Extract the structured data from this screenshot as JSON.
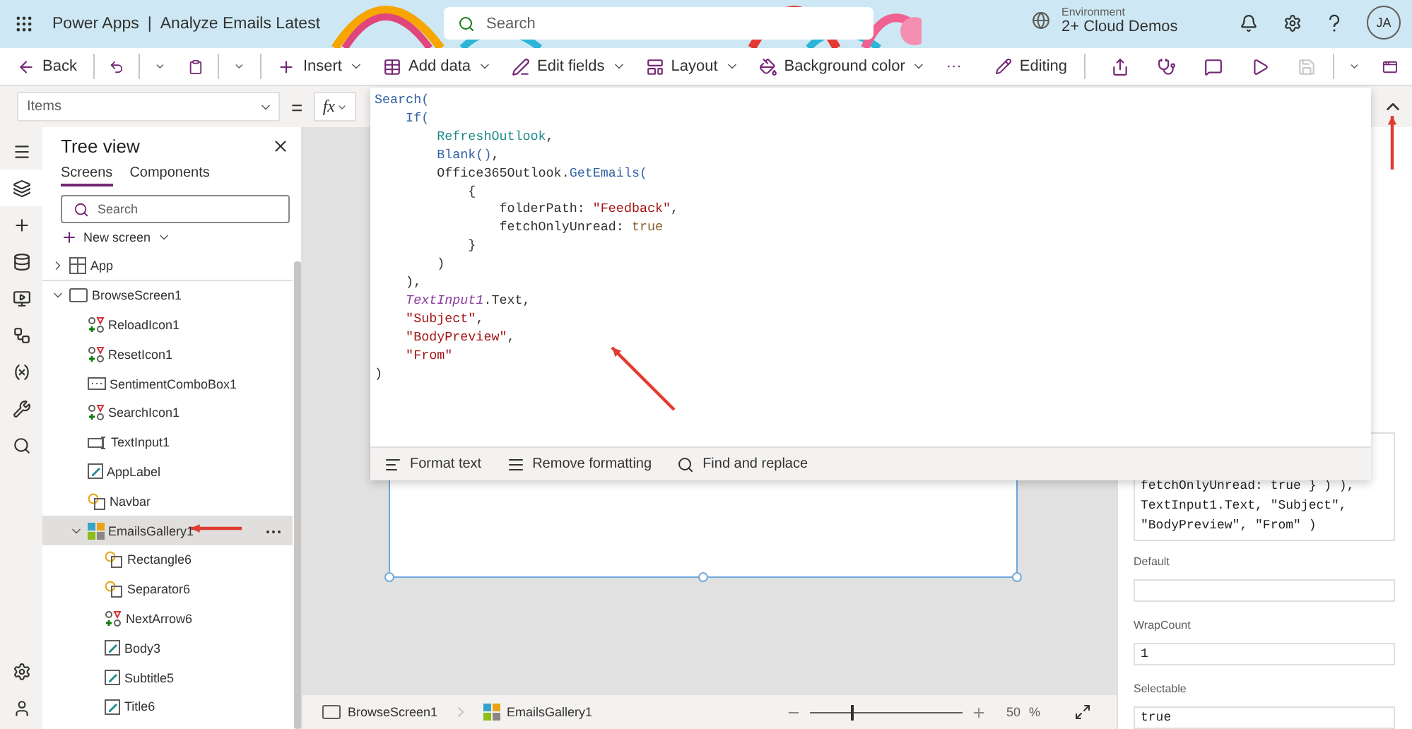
{
  "header": {
    "app_name": "Power Apps",
    "separator": "|",
    "app_title": "Analyze Emails Latest",
    "search": {
      "placeholder": "Search"
    },
    "environment": {
      "label": "Environment",
      "name": "2+ Cloud Demos"
    },
    "avatar": "JA"
  },
  "command_bar": {
    "left": [
      {
        "label": "Back",
        "dropdown": false
      },
      {
        "label": "Insert",
        "dropdown": true
      },
      {
        "label": "Add data",
        "dropdown": true
      },
      {
        "label": "Edit fields",
        "dropdown": true
      },
      {
        "label": "Layout",
        "dropdown": true
      },
      {
        "label": "Background color",
        "dropdown": true
      }
    ],
    "more": "···",
    "mode": "Editing",
    "tools": [
      {
        "disabled": false
      },
      {
        "disabled": false
      },
      {
        "disabled": false
      },
      {
        "disabled": false
      },
      {
        "disabled": true
      }
    ]
  },
  "formula_bar": {
    "property": "Items",
    "equals": "=",
    "fx": "fx",
    "code": [
      [
        {
          "text": "Search(",
          "kind": "func"
        }
      ],
      [
        {
          "text": "    If(",
          "kind": "func"
        }
      ],
      [
        {
          "text": "        RefreshOutlook",
          "kind": "ident"
        },
        {
          "text": ",",
          "kind": "plain"
        }
      ],
      [
        {
          "text": "        Blank()",
          "kind": "func"
        },
        {
          "text": ",",
          "kind": "plain"
        }
      ],
      [
        {
          "text": "        Office365Outlook.",
          "kind": "plain"
        },
        {
          "text": "GetEmails(",
          "kind": "func"
        }
      ],
      [
        {
          "text": "            {",
          "kind": "plain"
        }
      ],
      [
        {
          "text": "                folderPath: ",
          "kind": "plain"
        },
        {
          "text": "\"Feedback\"",
          "kind": "string"
        },
        {
          "text": ",",
          "kind": "plain"
        }
      ],
      [
        {
          "text": "                fetchOnlyUnread: ",
          "kind": "plain"
        },
        {
          "text": "true",
          "kind": "bool"
        }
      ],
      [
        {
          "text": "            }",
          "kind": "plain"
        }
      ],
      [
        {
          "text": "        )",
          "kind": "plain"
        }
      ],
      [
        {
          "text": "    ),",
          "kind": "plain"
        }
      ],
      [
        {
          "text": "    TextInput1",
          "kind": "control"
        },
        {
          "text": ".Text,",
          "kind": "plain"
        }
      ],
      [
        {
          "text": "    \"Subject\"",
          "kind": "string"
        },
        {
          "text": ",",
          "kind": "plain"
        }
      ],
      [
        {
          "text": "    \"BodyPreview\"",
          "kind": "string"
        },
        {
          "text": ",",
          "kind": "plain"
        }
      ],
      [
        {
          "text": "    \"From\"",
          "kind": "string"
        }
      ],
      [
        {
          "text": ")",
          "kind": "plain"
        }
      ]
    ],
    "toolbar": [
      "Format text",
      "Remove formatting",
      "Find and replace"
    ]
  },
  "rail": {
    "items": [
      {
        "selected": false
      },
      {
        "selected": true
      },
      {
        "selected": false
      },
      {
        "selected": false
      },
      {
        "selected": false
      },
      {
        "selected": false
      },
      {
        "selected": false
      },
      {
        "selected": false
      },
      {
        "selected": false
      }
    ]
  },
  "tree_view": {
    "title": "Tree view",
    "tabs": [
      {
        "label": "Screens",
        "selected": true
      },
      {
        "label": "Components",
        "selected": false
      }
    ],
    "search": {
      "placeholder": "Search"
    },
    "new_screen": "New screen",
    "items": [
      {
        "label": "App",
        "kind": "app",
        "expanded": false,
        "selected": false
      },
      {
        "label": "BrowseScreen1",
        "kind": "screen",
        "expanded": true,
        "selected": false,
        "children": [
          {
            "label": "ReloadIcon1",
            "kind": "icon",
            "selected": false
          },
          {
            "label": "ResetIcon1",
            "kind": "icon",
            "selected": false
          },
          {
            "label": "SentimentComboBox1",
            "kind": "combo",
            "selected": false
          },
          {
            "label": "SearchIcon1",
            "kind": "icon",
            "selected": false
          },
          {
            "label": "TextInput1",
            "kind": "input",
            "selected": false
          },
          {
            "label": "AppLabel",
            "kind": "label",
            "selected": false
          },
          {
            "label": "Navbar",
            "kind": "shape",
            "selected": false
          },
          {
            "label": "EmailsGallery1",
            "kind": "gallery",
            "expanded": true,
            "selected": true,
            "children": [
              {
                "label": "Rectangle6",
                "kind": "shape",
                "selected": false
              },
              {
                "label": "Separator6",
                "kind": "shape",
                "selected": false
              },
              {
                "label": "NextArrow6",
                "kind": "icon",
                "selected": false
              },
              {
                "label": "Body3",
                "kind": "label",
                "selected": false
              },
              {
                "label": "Subtitle5",
                "kind": "label",
                "selected": false
              },
              {
                "label": "Title6",
                "kind": "label",
                "selected": false
              }
            ]
          }
        ]
      }
    ]
  },
  "status_bar": {
    "breadcrumbs": [
      {
        "label": "BrowseScreen1",
        "kind": "screen"
      },
      {
        "label": "EmailsGallery1",
        "kind": "gallery"
      }
    ],
    "zoom": {
      "level": 0.27,
      "reading": "50",
      "unit": "%"
    }
  },
  "properties": {
    "items_text": [
      "fetchOnlyUnread: true } ) ),",
      "TextInput1.Text, \"Subject\",",
      "\"BodyPreview\", \"From\" )"
    ],
    "fields": [
      {
        "label": "Default"
      },
      {
        "label": "WrapCount",
        "value": "1"
      },
      {
        "label": "Selectable",
        "value": "true"
      }
    ]
  }
}
